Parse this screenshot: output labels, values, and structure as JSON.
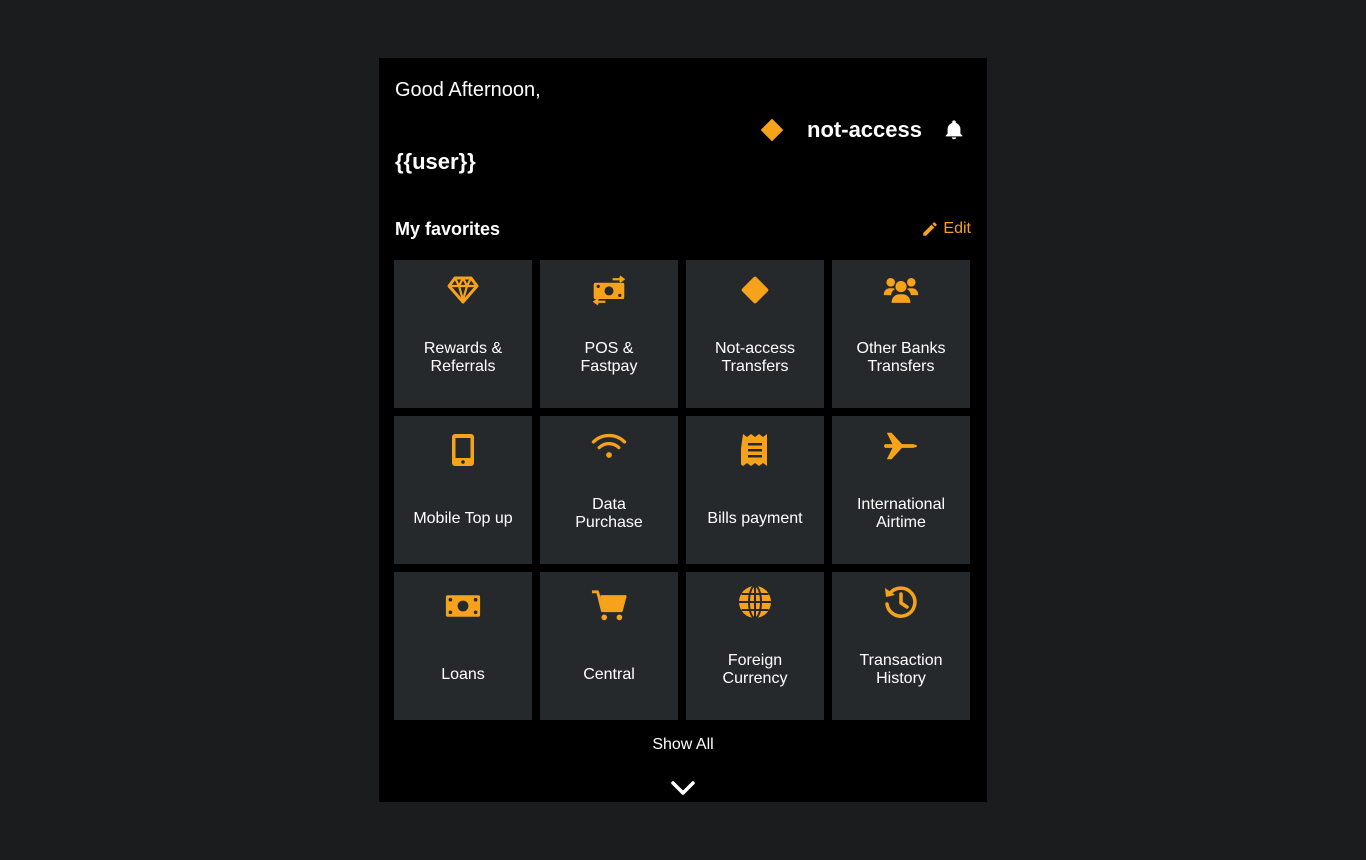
{
  "header": {
    "greeting": "Good Afternoon,",
    "user": "{{user}}",
    "brand_name": "not-access",
    "brand_icon": "diamond-logo",
    "notification_icon": "bell-icon"
  },
  "favorites": {
    "title": "My favorites",
    "edit_label": "Edit",
    "edit_icon": "pencil-icon",
    "tiles": [
      {
        "icon": "diamond-gem-icon",
        "label": "Rewards &\nReferrals"
      },
      {
        "icon": "money-exchange-icon",
        "label": "POS &\nFastpay"
      },
      {
        "icon": "diamond-logo-icon",
        "label": "Not-access\nTransfers"
      },
      {
        "icon": "users-icon",
        "label": "Other Banks\nTransfers"
      },
      {
        "icon": "mobile-phone-icon",
        "label": "Mobile Top up"
      },
      {
        "icon": "wifi-icon",
        "label": "Data\nPurchase"
      },
      {
        "icon": "receipt-icon",
        "label": "Bills payment"
      },
      {
        "icon": "plane-icon",
        "label": "International\nAirtime"
      },
      {
        "icon": "money-bill-icon",
        "label": "Loans"
      },
      {
        "icon": "cart-icon",
        "label": "Central"
      },
      {
        "icon": "globe-icon",
        "label": "Foreign\nCurrency"
      },
      {
        "icon": "history-icon",
        "label": "Transaction\nHistory"
      }
    ]
  },
  "footer": {
    "show_all_label": "Show All",
    "expand_icon": "chevron-down-icon"
  },
  "colors": {
    "accent": "#f7a21b",
    "tile_bg": "#26292b",
    "panel_bg": "#000000",
    "page_bg": "#1b1c1e"
  }
}
